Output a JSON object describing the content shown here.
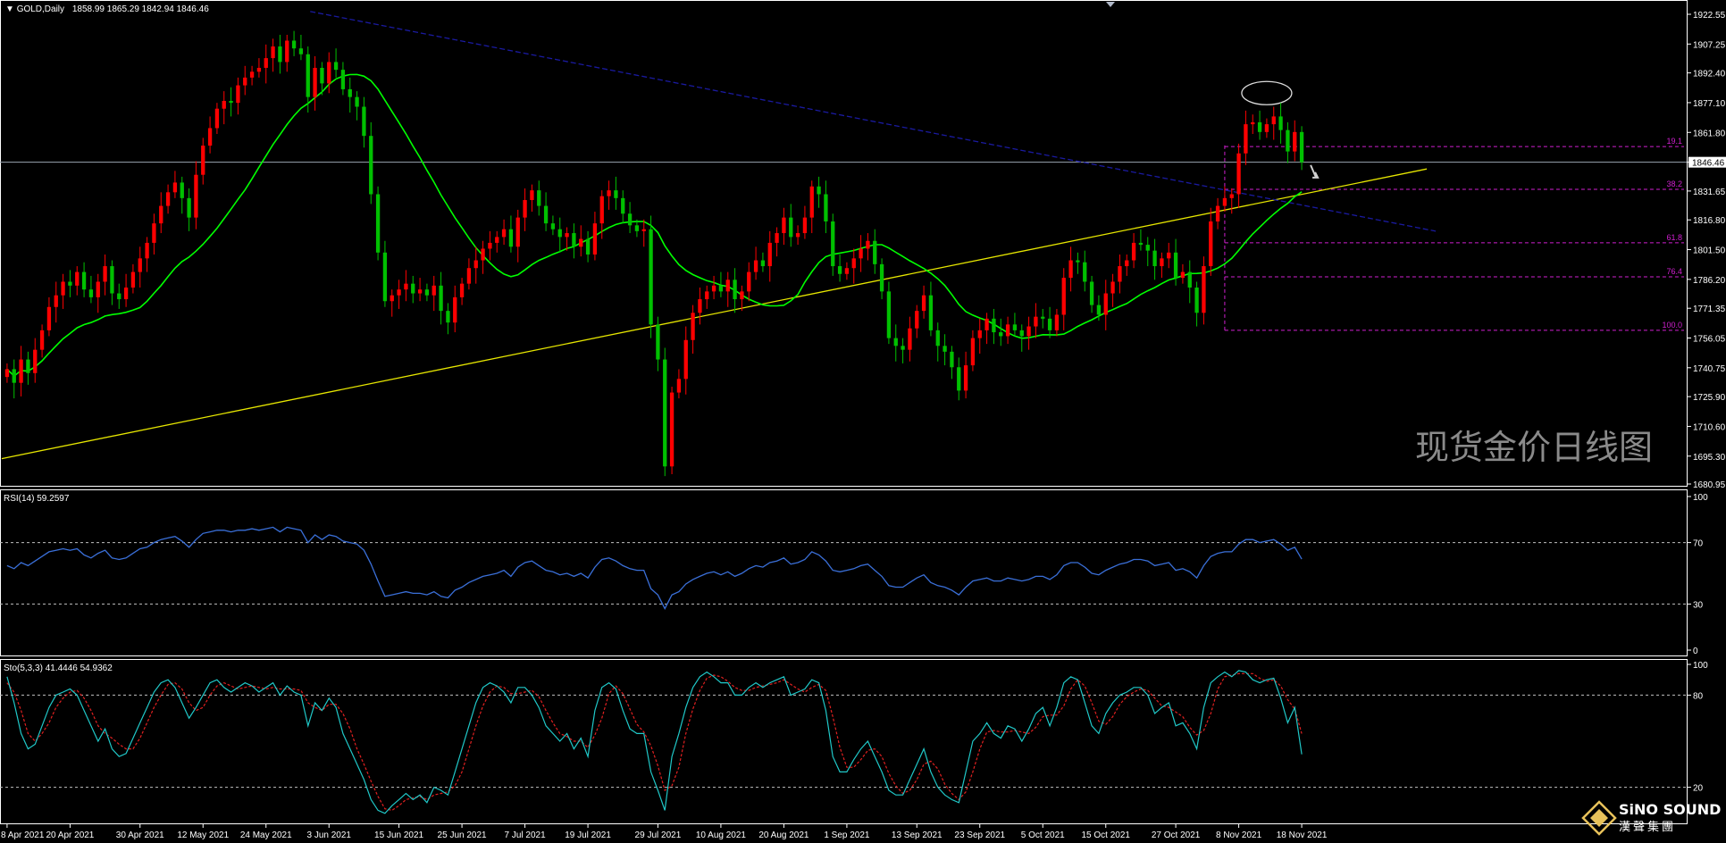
{
  "header": {
    "symbol": "GOLD,Daily",
    "ohlc": "1858.99 1865.29 1842.94 1846.46"
  },
  "watermark": "现货金价日线图",
  "logo": {
    "name": "SiNO SOUND",
    "subtitle": "漢聲集團"
  },
  "rsi_label": "RSI(14) 59.2597",
  "sto_label": "Sto(5,3,3) 41.4446 54.9362",
  "colors": {
    "bull": "#ff0000",
    "bear": "#00c000",
    "ma": "#00ff00",
    "trendline": "#e6e600",
    "channel": "#1a1aa0",
    "fib": "#d01fd0",
    "rsi": "#3a6fd8",
    "sto_main": "#20c8c8",
    "sto_signal": "#e02020"
  },
  "chart_data": [
    {
      "type": "candlestick",
      "title": "GOLD,Daily",
      "ylim": [
        1680.95,
        1922.55
      ],
      "y_ticks": [
        1922.55,
        1907.25,
        1892.4,
        1877.1,
        1861.8,
        1846.46,
        1831.65,
        1816.8,
        1801.5,
        1786.2,
        1771.35,
        1756.05,
        1740.75,
        1725.9,
        1710.6,
        1695.3,
        1680.95
      ],
      "x_ticks": [
        "8 Apr 2021",
        "20 Apr 2021",
        "30 Apr 2021",
        "12 May 2021",
        "24 May 2021",
        "3 Jun 2021",
        "15 Jun 2021",
        "25 Jun 2021",
        "7 Jul 2021",
        "19 Jul 2021",
        "29 Jul 2021",
        "10 Aug 2021",
        "20 Aug 2021",
        "1 Sep 2021",
        "13 Sep 2021",
        "23 Sep 2021",
        "5 Oct 2021",
        "15 Oct 2021",
        "27 Oct 2021",
        "8 Nov 2021",
        "18 Nov 2021"
      ],
      "last_price": 1846.46,
      "fibonacci": [
        {
          "label": "19.1",
          "price": 1854.5
        },
        {
          "label": "38.2",
          "price": 1832.5
        },
        {
          "label": "61.8",
          "price": 1805.0
        },
        {
          "label": "76.4",
          "price": 1787.5
        },
        {
          "label": "100.0",
          "price": 1760.0
        }
      ],
      "closes": [
        1740,
        1733,
        1745,
        1738,
        1750,
        1760,
        1772,
        1778,
        1785,
        1783,
        1790,
        1781,
        1777,
        1785,
        1793,
        1779,
        1776,
        1782,
        1790,
        1797,
        1805,
        1815,
        1824,
        1831,
        1836,
        1828,
        1818,
        1840,
        1855,
        1864,
        1874,
        1878,
        1877,
        1886,
        1890,
        1893,
        1895,
        1900,
        1906,
        1898,
        1909,
        1905,
        1902,
        1880,
        1895,
        1887,
        1898,
        1894,
        1884,
        1880,
        1875,
        1860,
        1830,
        1800,
        1775,
        1778,
        1781,
        1784,
        1779,
        1781,
        1778,
        1783,
        1770,
        1764,
        1777,
        1784,
        1792,
        1796,
        1802,
        1805,
        1808,
        1812,
        1803,
        1818,
        1827,
        1832,
        1824,
        1815,
        1812,
        1808,
        1810,
        1803,
        1807,
        1799,
        1815,
        1829,
        1832,
        1828,
        1820,
        1814,
        1811,
        1812,
        1763,
        1745,
        1690,
        1728,
        1735,
        1755,
        1769,
        1776,
        1780,
        1783,
        1780,
        1786,
        1776,
        1780,
        1790,
        1796,
        1793,
        1805,
        1810,
        1818,
        1808,
        1810,
        1818,
        1834,
        1830,
        1816,
        1793,
        1789,
        1792,
        1797,
        1802,
        1806,
        1794,
        1780,
        1756,
        1752,
        1750,
        1761,
        1770,
        1778,
        1760,
        1752,
        1749,
        1741,
        1729,
        1742,
        1756,
        1760,
        1766,
        1759,
        1757,
        1763,
        1760,
        1757,
        1762,
        1767,
        1766,
        1760,
        1768,
        1787,
        1796,
        1795,
        1785,
        1773,
        1768,
        1779,
        1785,
        1793,
        1796,
        1805,
        1804,
        1801,
        1793,
        1797,
        1800,
        1787,
        1790,
        1782,
        1769,
        1793,
        1816,
        1824,
        1828,
        1830,
        1851,
        1866,
        1867,
        1862,
        1866,
        1870,
        1863,
        1852,
        1862,
        1846.46
      ],
      "ma_period": 20
    },
    {
      "type": "line",
      "title": "RSI(14) 59.2597",
      "ylim": [
        0,
        100
      ],
      "y_ticks": [
        100,
        70,
        30,
        0
      ],
      "levels": [
        70,
        30
      ],
      "series": [
        {
          "name": "RSI(14)",
          "values": [
            55,
            53,
            57,
            55,
            58,
            61,
            64,
            65,
            66,
            65,
            66,
            62,
            60,
            63,
            65,
            60,
            59,
            60,
            63,
            66,
            67,
            70,
            72,
            73,
            74,
            71,
            67,
            72,
            76,
            77,
            78,
            78,
            77,
            78,
            78,
            79,
            78,
            79,
            80,
            77,
            80,
            79,
            78,
            70,
            75,
            72,
            75,
            74,
            71,
            70,
            69,
            65,
            56,
            45,
            35,
            36,
            37,
            38,
            37,
            37,
            36,
            38,
            35,
            34,
            39,
            41,
            44,
            46,
            48,
            49,
            50,
            52,
            48,
            54,
            57,
            58,
            55,
            52,
            51,
            49,
            50,
            48,
            50,
            47,
            54,
            59,
            60,
            58,
            55,
            53,
            52,
            52,
            40,
            36,
            27,
            36,
            38,
            43,
            46,
            48,
            50,
            51,
            49,
            51,
            48,
            50,
            53,
            55,
            54,
            57,
            58,
            60,
            56,
            57,
            59,
            64,
            62,
            58,
            52,
            51,
            52,
            53,
            55,
            56,
            52,
            48,
            42,
            41,
            41,
            44,
            47,
            49,
            44,
            42,
            41,
            39,
            36,
            41,
            45,
            46,
            47,
            45,
            45,
            47,
            46,
            45,
            46,
            48,
            48,
            46,
            49,
            55,
            57,
            57,
            54,
            50,
            49,
            52,
            54,
            56,
            57,
            59,
            59,
            58,
            55,
            56,
            57,
            52,
            53,
            51,
            47,
            55,
            61,
            63,
            64,
            64,
            69,
            72,
            72,
            70,
            71,
            72,
            69,
            65,
            67,
            59.26
          ]
        }
      ]
    },
    {
      "type": "line",
      "title": "Sto(5,3,3) 41.4446 54.9362",
      "ylim": [
        0,
        100
      ],
      "y_ticks": [
        100,
        80,
        20
      ],
      "levels": [
        80,
        20
      ],
      "series": [
        {
          "name": "Sto main",
          "values": [
            92,
            75,
            55,
            45,
            48,
            60,
            72,
            80,
            82,
            84,
            80,
            70,
            60,
            50,
            58,
            45,
            40,
            42,
            52,
            62,
            72,
            82,
            88,
            90,
            85,
            75,
            65,
            72,
            80,
            88,
            90,
            85,
            82,
            85,
            88,
            86,
            82,
            85,
            88,
            80,
            86,
            82,
            80,
            60,
            75,
            70,
            78,
            72,
            55,
            45,
            35,
            25,
            12,
            5,
            3,
            8,
            12,
            16,
            12,
            15,
            10,
            20,
            18,
            15,
            30,
            45,
            60,
            75,
            85,
            88,
            86,
            82,
            75,
            85,
            85,
            80,
            72,
            60,
            55,
            50,
            55,
            45,
            52,
            40,
            70,
            85,
            88,
            84,
            70,
            58,
            55,
            55,
            30,
            18,
            5,
            40,
            55,
            72,
            85,
            92,
            95,
            92,
            88,
            88,
            80,
            80,
            85,
            88,
            85,
            88,
            90,
            92,
            80,
            82,
            84,
            90,
            88,
            70,
            40,
            30,
            30,
            38,
            45,
            50,
            40,
            30,
            18,
            15,
            15,
            25,
            35,
            45,
            30,
            20,
            15,
            12,
            10,
            30,
            50,
            55,
            62,
            55,
            52,
            60,
            58,
            50,
            58,
            68,
            72,
            60,
            72,
            88,
            92,
            90,
            75,
            60,
            55,
            68,
            75,
            80,
            82,
            85,
            85,
            80,
            68,
            72,
            75,
            60,
            62,
            55,
            45,
            72,
            88,
            92,
            95,
            92,
            96,
            95,
            90,
            88,
            90,
            91,
            78,
            62,
            72,
            41.44
          ]
        },
        {
          "name": "Sto signal",
          "values": [
            88,
            82,
            70,
            55,
            50,
            55,
            62,
            72,
            78,
            82,
            83,
            78,
            70,
            60,
            55,
            52,
            48,
            45,
            45,
            52,
            62,
            72,
            80,
            87,
            88,
            84,
            75,
            70,
            72,
            80,
            86,
            88,
            86,
            84,
            85,
            86,
            85,
            84,
            85,
            84,
            84,
            84,
            83,
            75,
            72,
            70,
            74,
            74,
            68,
            58,
            45,
            35,
            24,
            14,
            6,
            5,
            8,
            12,
            13,
            14,
            12,
            15,
            16,
            17,
            21,
            30,
            45,
            60,
            73,
            82,
            86,
            85,
            81,
            81,
            82,
            83,
            79,
            70,
            62,
            55,
            53,
            50,
            50,
            46,
            54,
            65,
            81,
            86,
            81,
            71,
            61,
            56,
            47,
            34,
            18,
            21,
            33,
            55,
            71,
            83,
            91,
            93,
            92,
            89,
            85,
            83,
            83,
            85,
            86,
            87,
            88,
            90,
            87,
            84,
            82,
            85,
            87,
            83,
            66,
            46,
            33,
            33,
            38,
            44,
            45,
            40,
            29,
            21,
            16,
            18,
            25,
            35,
            37,
            32,
            22,
            16,
            12,
            17,
            30,
            45,
            56,
            57,
            56,
            56,
            57,
            56,
            55,
            59,
            66,
            67,
            67,
            73,
            84,
            90,
            86,
            75,
            63,
            61,
            66,
            74,
            79,
            82,
            84,
            83,
            78,
            73,
            72,
            69,
            66,
            59,
            54,
            57,
            68,
            84,
            92,
            93,
            94,
            94,
            94,
            91,
            89,
            90,
            86,
            77,
            71,
            54.94
          ]
        }
      ]
    }
  ]
}
